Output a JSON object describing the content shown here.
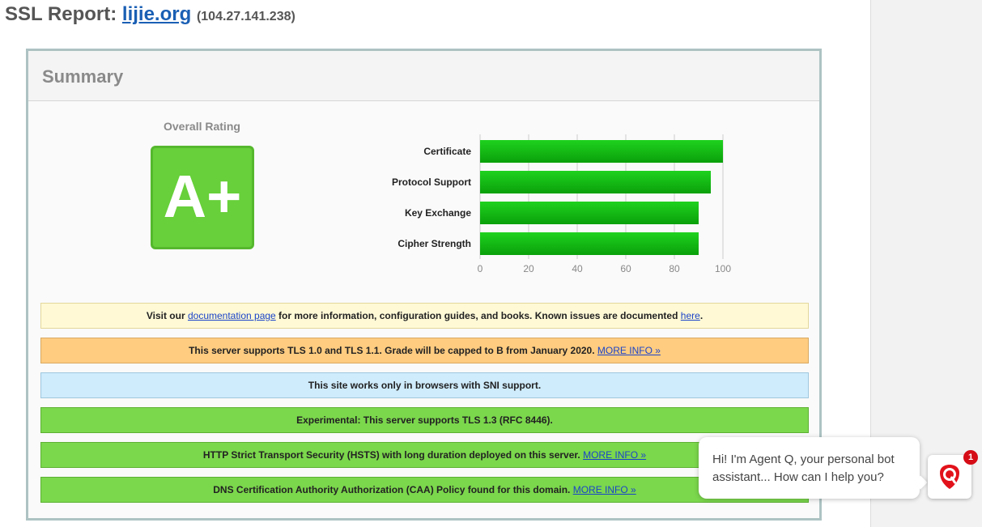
{
  "report": {
    "title_prefix": "SSL Report: ",
    "domain": "lijie.org",
    "ip": "(104.27.141.238)"
  },
  "summary": {
    "heading": "Summary",
    "overall_rating_label": "Overall Rating",
    "grade": "A+",
    "grade_color": "#67d03a"
  },
  "chart_data": {
    "type": "bar",
    "orientation": "horizontal",
    "categories": [
      "Certificate",
      "Protocol Support",
      "Key Exchange",
      "Cipher Strength"
    ],
    "values": [
      100,
      95,
      90,
      90
    ],
    "x_ticks": [
      0,
      20,
      40,
      60,
      80,
      100
    ],
    "xlim": [
      0,
      100
    ],
    "grid": true,
    "bar_color": "#16b516"
  },
  "notices": {
    "doc": {
      "text_before": "Visit our ",
      "link1": "documentation page",
      "text_middle": " for more information, configuration guides, and books. Known issues are documented ",
      "link2": "here",
      "text_after": "."
    },
    "tls": {
      "text": "This server supports TLS 1.0 and TLS 1.1. Grade will be capped to B from January 2020. ",
      "link": "MORE INFO »"
    },
    "sni": {
      "text": "This site works only in browsers with SNI support."
    },
    "tls13": {
      "text": "Experimental: This server supports TLS 1.3 (RFC 8446)."
    },
    "hsts": {
      "text": "HTTP Strict Transport Security (HSTS) with long duration deployed on this server.  ",
      "link": "MORE INFO »"
    },
    "caa": {
      "text": "DNS Certification Authority Authorization (CAA) Policy found for this domain.  ",
      "link": "MORE INFO »"
    }
  },
  "chat": {
    "message": "Hi! I'm Agent Q, your personal bot assistant... How can I help you?",
    "badge_count": "1",
    "icon": "qualys-shield-icon"
  }
}
